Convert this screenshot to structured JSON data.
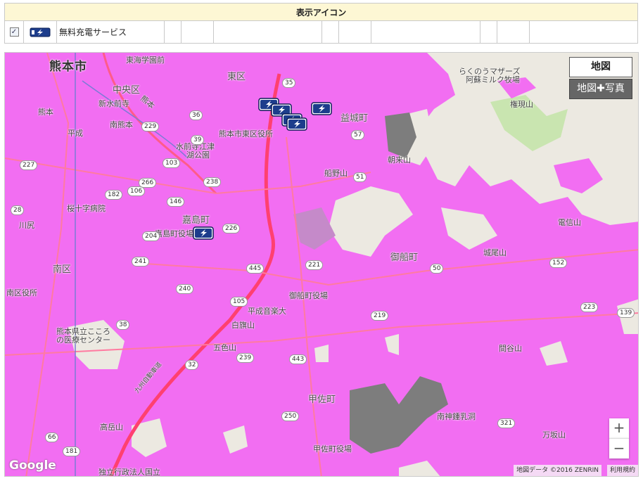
{
  "legend": {
    "header": "表示アイコン",
    "checked": true,
    "check_mark": "✓",
    "item_label": "無料充電サービス"
  },
  "map_type": {
    "map_label": "地図",
    "hybrid_label": "地図✚写真",
    "selected": "map"
  },
  "zoom": {
    "in_label": "+",
    "out_label": "−"
  },
  "attribution": {
    "data": "地図データ ©2016 ZENRIN",
    "terms": "利用規約"
  },
  "google_logo": "Google",
  "colors": {
    "coverage": "#f26ef2",
    "land": "#ece9e1",
    "gap": "#7d7d7d",
    "road": "#ff5b8a"
  },
  "labels": {
    "kumamoto_city": "熊本市",
    "higashi_gakuen": "東海学園前",
    "higashi_ku": "東区",
    "chuo_ku": "中央区",
    "shin_suizenji": "新水前寺",
    "kumamoto": "熊本",
    "minami_kumamoto": "南熊本",
    "heisei": "平成",
    "higashi_kuyakusho": "熊本市東区役所",
    "suizenji_ezu": "水前寺江津",
    "kosui_koen": "湖公園",
    "mashiki": "益城町",
    "asakuyama": "朝来山",
    "funanoyama": "船野山",
    "sakuraju": "桜十字病院",
    "kashima": "嘉島町",
    "kashima_office": "嘉島町役場",
    "kawashiri": "川尻",
    "minami_ku": "南区",
    "minami_kuyakusho": "南区役所",
    "mifune": "御船町",
    "mifune_office": "御船町役場",
    "heisei_ongaku": "平成音楽大",
    "shirohata": "白旗山",
    "goshiki": "五色山",
    "kiyo_center": "熊本県立こころ",
    "kiyo_center2": "の医療センター",
    "kosa": "甲佐町",
    "kosa_office": "甲佐町役場",
    "takarayama": "高岳山",
    "dokuritsu": "独立行政法人国立",
    "asoeki": "らくのうマザーズ",
    "aso_milk": "阿蘇ミルク牧場",
    "gongenyama": "権現山",
    "takigiyama": "電信山",
    "joryozan": "城尾山",
    "mayuyama": "間谷山",
    "chikan": "南神鍾乳洞",
    "mansaka": "万坂山",
    "kumamoto_kotsu": "熊本",
    "expressway": "九州自動車道"
  },
  "shields": [
    "35",
    "36",
    "57",
    "103",
    "238",
    "266",
    "182",
    "106",
    "226",
    "240",
    "241",
    "445",
    "221",
    "105",
    "38",
    "239",
    "32",
    "443",
    "219",
    "152",
    "223",
    "181",
    "66",
    "250",
    "229",
    "227",
    "28",
    "204",
    "321",
    "50",
    "39",
    "51",
    "146",
    "139"
  ],
  "ev_markers": 6
}
